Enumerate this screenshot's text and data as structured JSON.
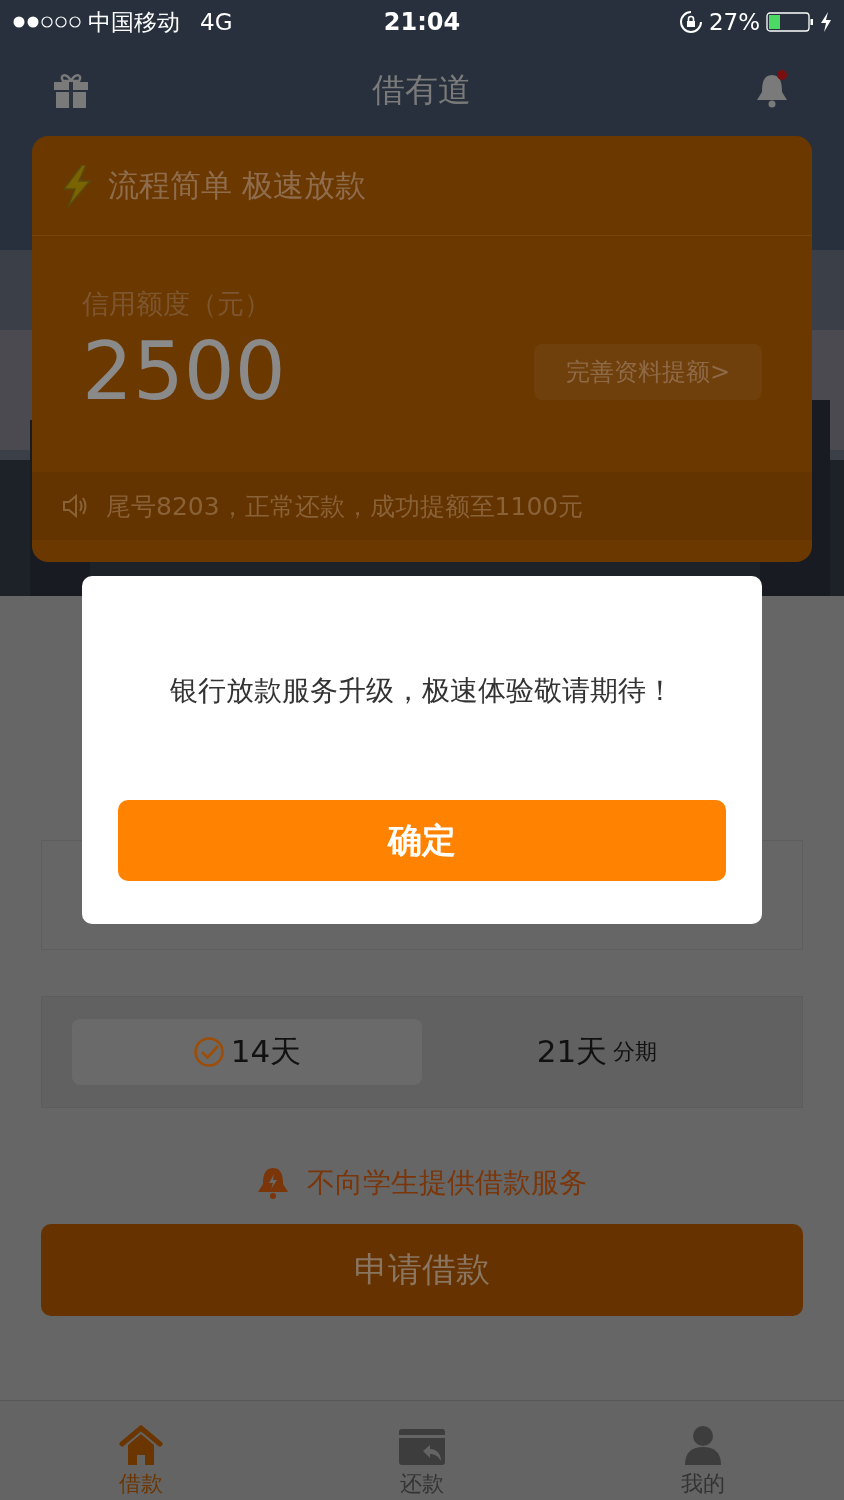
{
  "status_bar": {
    "carrier": "中国移动",
    "network": "4G",
    "time": "21:04",
    "battery": "27%"
  },
  "header": {
    "title": "借有道",
    "unread": true
  },
  "card": {
    "headline": "流程简单 极速放款",
    "credit_label": "信用额度（元）",
    "amount": "2500",
    "raise_button": "完善资料提额>",
    "notice": "尾号8203，正常还款，成功提额至1100元"
  },
  "periods": [
    {
      "label": "14天",
      "selected": true
    },
    {
      "label": "21天",
      "suffix": "分期",
      "selected": false
    }
  ],
  "student_notice": "不向学生提供借款服务",
  "apply_button": "申请借款",
  "tabs": [
    {
      "label": "借款",
      "kind": "home",
      "selected": true
    },
    {
      "label": "还款",
      "kind": "repay",
      "selected": false
    },
    {
      "label": "我的",
      "kind": "profile",
      "selected": false
    }
  ],
  "dialog": {
    "message": "银行放款服务升级，极速体验敬请期待！",
    "confirm": "确定"
  }
}
